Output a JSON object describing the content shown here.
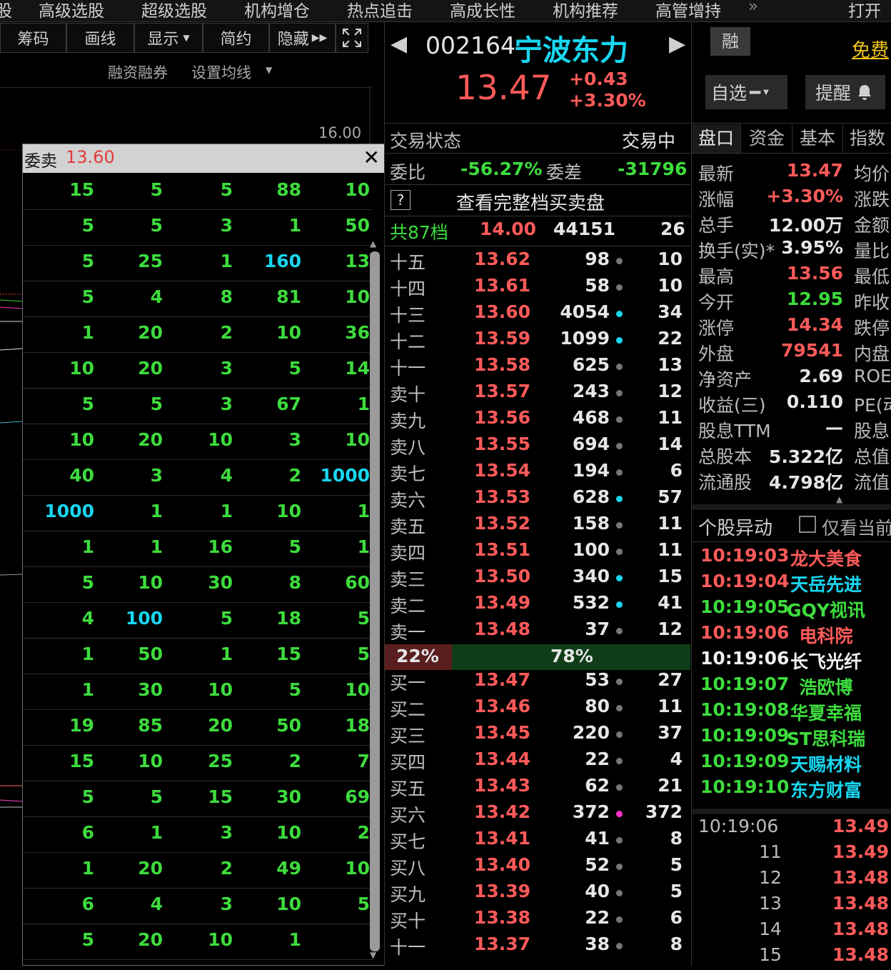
{
  "topnav": {
    "items": [
      "股",
      "高级选股",
      "超级选股",
      "机构增仓",
      "热点追击",
      "高成长性",
      "机构推荐",
      "高管增持",
      "»",
      "打开"
    ]
  },
  "toolbar": {
    "buttons": [
      "筹码",
      "画线",
      "显示",
      "简约",
      "隐藏"
    ],
    "sub": [
      "融资融券",
      "设置均线"
    ],
    "axis_label": "16.00"
  },
  "popup": {
    "title": "委卖",
    "price": "13.60",
    "close": "✕",
    "rows": [
      [
        "15",
        "5",
        "5",
        "88",
        "10"
      ],
      [
        "5",
        "5",
        "3",
        "1",
        "50"
      ],
      [
        "5",
        "25",
        "1",
        "160",
        "13"
      ],
      [
        "5",
        "4",
        "8",
        "81",
        "10"
      ],
      [
        "1",
        "20",
        "2",
        "10",
        "36"
      ],
      [
        "10",
        "20",
        "3",
        "5",
        "14"
      ],
      [
        "5",
        "5",
        "3",
        "67",
        "1"
      ],
      [
        "10",
        "20",
        "10",
        "3",
        "10"
      ],
      [
        "40",
        "3",
        "4",
        "2",
        "1000"
      ],
      [
        "1000",
        "1",
        "1",
        "10",
        "1"
      ],
      [
        "1",
        "1",
        "16",
        "5",
        "1"
      ],
      [
        "5",
        "10",
        "30",
        "8",
        "60"
      ],
      [
        "4",
        "100",
        "5",
        "18",
        "5"
      ],
      [
        "1",
        "50",
        "1",
        "15",
        "5"
      ],
      [
        "1",
        "30",
        "10",
        "5",
        "10"
      ],
      [
        "19",
        "85",
        "20",
        "50",
        "18"
      ],
      [
        "15",
        "10",
        "25",
        "2",
        "7"
      ],
      [
        "5",
        "5",
        "15",
        "30",
        "69"
      ],
      [
        "6",
        "1",
        "3",
        "10",
        "2"
      ],
      [
        "1",
        "20",
        "2",
        "49",
        "10"
      ],
      [
        "6",
        "4",
        "3",
        "10",
        "5"
      ],
      [
        "5",
        "20",
        "10",
        "1",
        ""
      ]
    ]
  },
  "stock": {
    "code": "002164",
    "name": "宁波东力",
    "price": "13.47",
    "change": "+0.43",
    "change_pct": "+3.30%",
    "rong": "融",
    "free": "免费",
    "watch": "自选",
    "alert": "提醒"
  },
  "status": {
    "label": "交易状态",
    "value": "交易中",
    "ratio_label": "委比",
    "ratio": "-56.27%",
    "diff_label": "委差",
    "diff": "-31796",
    "full_depth_q": "?",
    "full_depth": "查看完整档买卖盘",
    "total_label": "共87档",
    "total_price": "14.00",
    "total_vol": "44151",
    "total_cnt": "26"
  },
  "sell": [
    {
      "label": "十五",
      "price": "13.62",
      "vol": "98",
      "dot": "#777",
      "cnt": "10"
    },
    {
      "label": "十四",
      "price": "13.61",
      "vol": "58",
      "dot": "#777",
      "cnt": "10"
    },
    {
      "label": "十三",
      "price": "13.60",
      "vol": "4054",
      "dot": "#18d6f0",
      "cnt": "34"
    },
    {
      "label": "十二",
      "price": "13.59",
      "vol": "1099",
      "dot": "#18d6f0",
      "cnt": "22"
    },
    {
      "label": "十一",
      "price": "13.58",
      "vol": "625",
      "dot": "#777",
      "cnt": "13"
    },
    {
      "label": "卖十",
      "price": "13.57",
      "vol": "243",
      "dot": "#777",
      "cnt": "12"
    },
    {
      "label": "卖九",
      "price": "13.56",
      "vol": "468",
      "dot": "#777",
      "cnt": "11"
    },
    {
      "label": "卖八",
      "price": "13.55",
      "vol": "694",
      "dot": "#777",
      "cnt": "14"
    },
    {
      "label": "卖七",
      "price": "13.54",
      "vol": "194",
      "dot": "#777",
      "cnt": "6"
    },
    {
      "label": "卖六",
      "price": "13.53",
      "vol": "628",
      "dot": "#18d6f0",
      "cnt": "57"
    },
    {
      "label": "卖五",
      "price": "13.52",
      "vol": "158",
      "dot": "#777",
      "cnt": "11"
    },
    {
      "label": "卖四",
      "price": "13.51",
      "vol": "100",
      "dot": "#777",
      "cnt": "11"
    },
    {
      "label": "卖三",
      "price": "13.50",
      "vol": "340",
      "dot": "#18d6f0",
      "cnt": "15"
    },
    {
      "label": "卖二",
      "price": "13.49",
      "vol": "532",
      "dot": "#18d6f0",
      "cnt": "41"
    },
    {
      "label": "卖一",
      "price": "13.48",
      "vol": "37",
      "dot": "#777",
      "cnt": "12"
    }
  ],
  "balance": {
    "buy_pct": "22%",
    "sell_pct": "78%",
    "buy_ratio": 0.22
  },
  "buy": [
    {
      "label": "买一",
      "price": "13.47",
      "vol": "53",
      "dot": "#777",
      "cnt": "27"
    },
    {
      "label": "买二",
      "price": "13.46",
      "vol": "80",
      "dot": "#777",
      "cnt": "11"
    },
    {
      "label": "买三",
      "price": "13.45",
      "vol": "220",
      "dot": "#777",
      "cnt": "37"
    },
    {
      "label": "买四",
      "price": "13.44",
      "vol": "22",
      "dot": "#777",
      "cnt": "4"
    },
    {
      "label": "买五",
      "price": "13.43",
      "vol": "62",
      "dot": "#777",
      "cnt": "21"
    },
    {
      "label": "买六",
      "price": "13.42",
      "vol": "372",
      "dot": "#ff33cc",
      "cnt": "372"
    },
    {
      "label": "买七",
      "price": "13.41",
      "vol": "41",
      "dot": "#777",
      "cnt": "8"
    },
    {
      "label": "买八",
      "price": "13.40",
      "vol": "52",
      "dot": "#777",
      "cnt": "5"
    },
    {
      "label": "买九",
      "price": "13.39",
      "vol": "40",
      "dot": "#777",
      "cnt": "5"
    },
    {
      "label": "买十",
      "price": "13.38",
      "vol": "22",
      "dot": "#777",
      "cnt": "6"
    },
    {
      "label": "十一",
      "price": "13.37",
      "vol": "38",
      "dot": "#777",
      "cnt": "8"
    }
  ],
  "tabs": [
    "盘口",
    "资金",
    "基本",
    "指数"
  ],
  "quote": [
    {
      "k": "最新",
      "v": "13.47",
      "c": "red",
      "k2": "均价"
    },
    {
      "k": "涨幅",
      "v": "+3.30%",
      "c": "red",
      "k2": "涨跌"
    },
    {
      "k": "总手",
      "v": "12.00万",
      "c": "white",
      "k2": "金额"
    },
    {
      "k": "换手(实)*",
      "v": "3.95%",
      "c": "white",
      "k2": "量比"
    },
    {
      "k": "最高",
      "v": "13.56",
      "c": "red",
      "k2": "最低"
    },
    {
      "k": "今开",
      "v": "12.95",
      "c": "green",
      "k2": "昨收"
    },
    {
      "k": "涨停",
      "v": "14.34",
      "c": "red",
      "k2": "跌停"
    },
    {
      "k": "外盘",
      "v": "79541",
      "c": "red",
      "k2": "内盘"
    },
    {
      "k": "净资产",
      "v": "2.69",
      "c": "white",
      "k2": "ROE"
    },
    {
      "k": "收益(三)",
      "v": "0.110",
      "c": "white",
      "k2": "PE(动"
    },
    {
      "k": "股息TTM",
      "v": "—",
      "c": "white",
      "k2": "股息"
    },
    {
      "k": "总股本",
      "v": "5.322亿",
      "c": "white",
      "k2": "总值"
    },
    {
      "k": "流通股",
      "v": "4.798亿",
      "c": "white",
      "k2": "流值"
    }
  ],
  "alerts": {
    "title": "个股异动",
    "only_current": "仅看当前",
    "rows": [
      {
        "t": "10:19:03",
        "n": "龙大美食",
        "tc": "red",
        "nc": "red"
      },
      {
        "t": "10:19:04",
        "n": "天岳先进",
        "tc": "red",
        "nc": "cyan"
      },
      {
        "t": "10:19:05",
        "n": "GQY视讯",
        "tc": "green",
        "nc": "green"
      },
      {
        "t": "10:19:06",
        "n": "电科院",
        "tc": "red",
        "nc": "red"
      },
      {
        "t": "10:19:06",
        "n": "长飞光纤",
        "tc": "white",
        "nc": "white"
      },
      {
        "t": "10:19:07",
        "n": "浩欧博",
        "tc": "green",
        "nc": "green"
      },
      {
        "t": "10:19:08",
        "n": "华夏幸福",
        "tc": "green",
        "nc": "green"
      },
      {
        "t": "10:19:09",
        "n": "ST思科瑞",
        "tc": "green",
        "nc": "green"
      },
      {
        "t": "10:19:09",
        "n": "天赐材料",
        "tc": "green",
        "nc": "cyan"
      },
      {
        "t": "10:19:10",
        "n": "东方财富",
        "tc": "green",
        "nc": "cyan"
      }
    ]
  },
  "ticks": [
    {
      "t": "10:19:06",
      "p": "13.49"
    },
    {
      "t": "11",
      "p": "13.49"
    },
    {
      "t": "12",
      "p": "13.48"
    },
    {
      "t": "13",
      "p": "13.48"
    },
    {
      "t": "14",
      "p": "13.48"
    },
    {
      "t": "15",
      "p": "13.48"
    }
  ]
}
